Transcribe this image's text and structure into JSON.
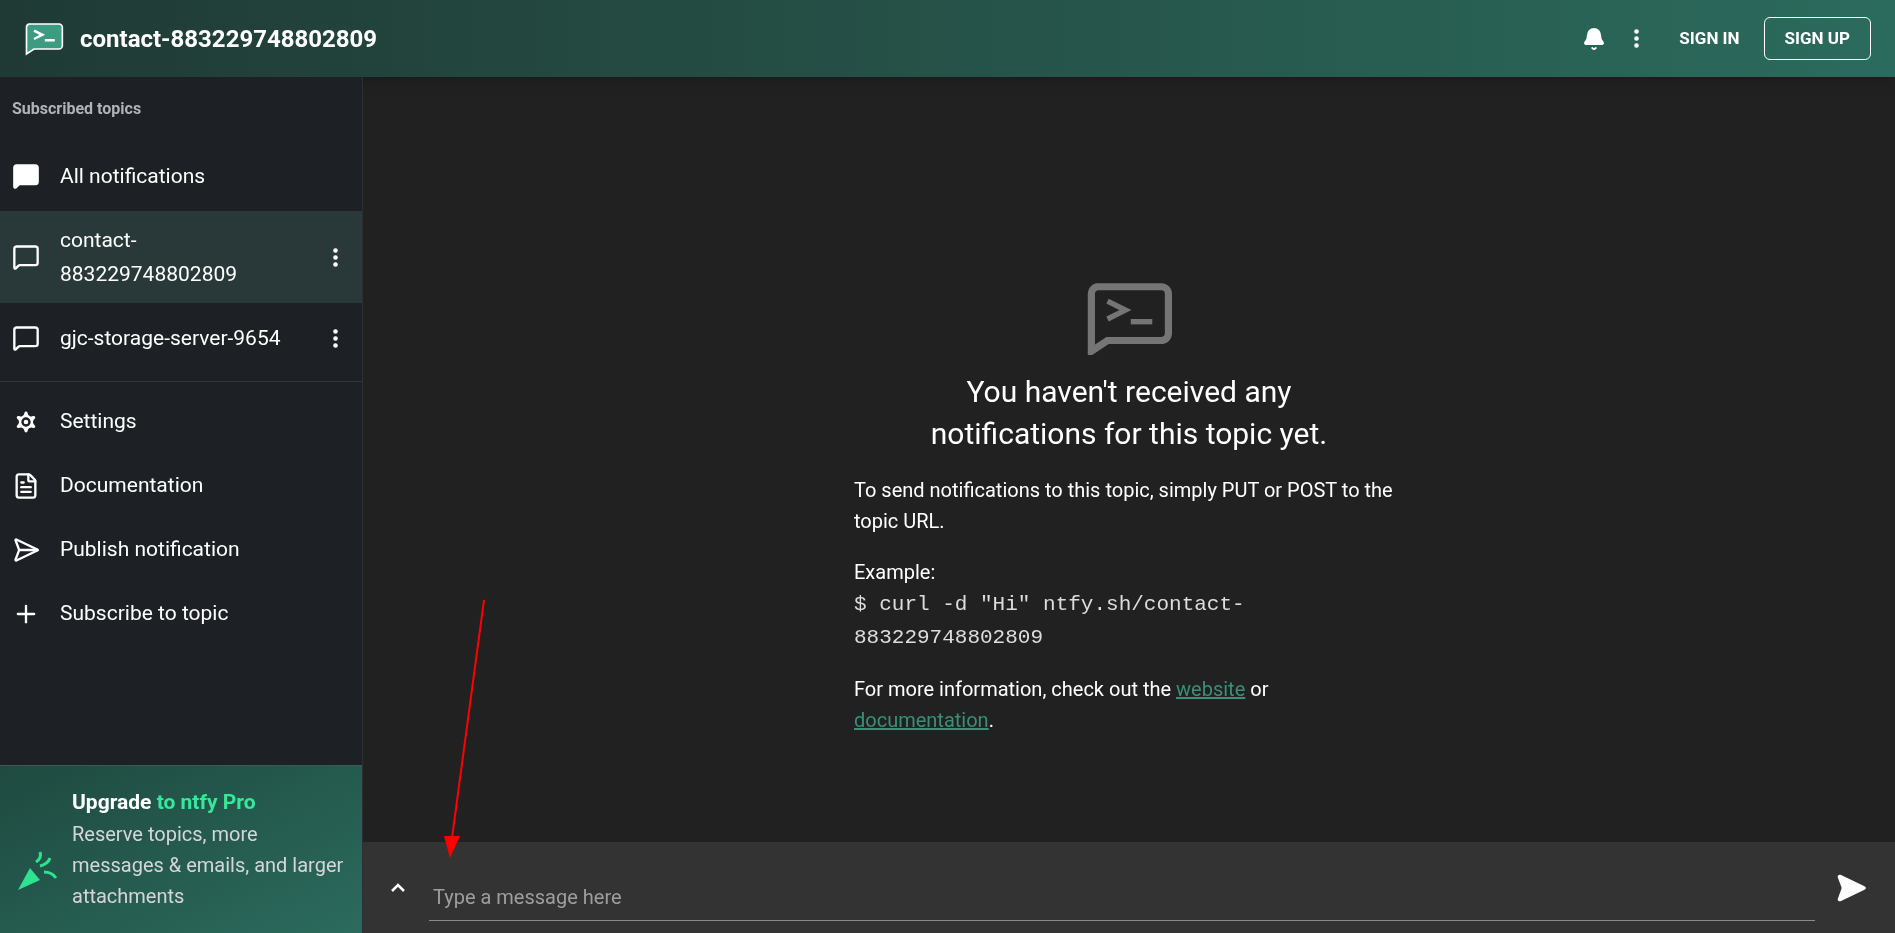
{
  "header": {
    "title": "contact-883229748802809",
    "sign_in": "SIGN IN",
    "sign_up": "SIGN UP"
  },
  "sidebar": {
    "heading": "Subscribed topics",
    "topics": [
      {
        "kind": "all",
        "label": "All notifications",
        "selected": false,
        "menu": false
      },
      {
        "kind": "topic",
        "label": "contact-883229748802809",
        "selected": true,
        "menu": true
      },
      {
        "kind": "topic",
        "label": "gjc-storage-server-9654",
        "selected": false,
        "menu": true
      }
    ],
    "actions": [
      {
        "kind": "settings",
        "label": "Settings"
      },
      {
        "kind": "docs",
        "label": "Documentation"
      },
      {
        "kind": "publish",
        "label": "Publish notification"
      },
      {
        "kind": "subscribe",
        "label": "Subscribe to topic"
      }
    ],
    "promo": {
      "title": "Upgrade",
      "title_accent": "to ntfy Pro",
      "text": "Reserve topics, more messages & emails, and larger attachments"
    }
  },
  "main": {
    "heading": "You haven't received any notifications for this topic yet.",
    "intro": "To send notifications to this topic, simply PUT or POST to the topic URL.",
    "example_label": "Example:",
    "example_code": "$ curl -d \"Hi\" ntfy.sh/contact-883229748802809",
    "more_prefix": "For more information, check out the",
    "link_website": "website",
    "more_or": "or",
    "link_docs": "documentation",
    "more_suffix": "."
  },
  "composer": {
    "placeholder": "Type a message here"
  }
}
